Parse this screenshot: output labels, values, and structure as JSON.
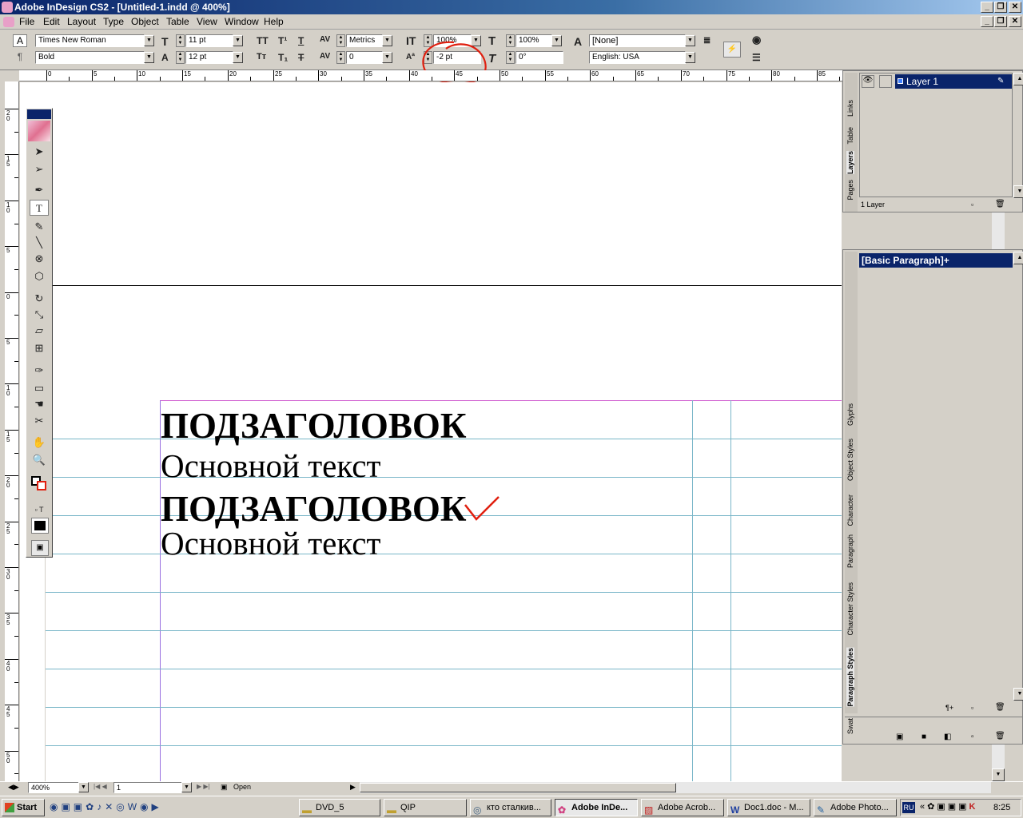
{
  "window": {
    "title": "Adobe InDesign CS2 - [Untitled-1.indd @ 400%]"
  },
  "menu": [
    "File",
    "Edit",
    "Layout",
    "Type",
    "Object",
    "Table",
    "View",
    "Window",
    "Help"
  ],
  "control_panel": {
    "font_family": "Times New Roman",
    "font_style": "Bold",
    "font_size": "11 pt",
    "leading": "12 pt",
    "kerning": "Metrics",
    "tracking": "0",
    "vertical_scale": "100%",
    "horizontal_scale": "100%",
    "baseline_shift": "-2 pt",
    "skew": "0°",
    "char_style": "[None]",
    "language": "English: USA",
    "para_mark": "¶",
    "char_mark": "A"
  },
  "ruler": {
    "h_labels": [
      "0",
      "5",
      "10",
      "15",
      "20",
      "25",
      "30",
      "35",
      "40",
      "45",
      "50",
      "55",
      "60",
      "65",
      "70",
      "75",
      "80",
      "85"
    ],
    "v_labels": [
      "20",
      "15",
      "10",
      "5",
      "0",
      "5",
      "10",
      "15",
      "20",
      "25",
      "30",
      "35",
      "40",
      "45",
      "50"
    ]
  },
  "document": {
    "lines": [
      "ПОДЗАГОЛОВОК",
      "Основной текст",
      "ПОДЗАГОЛОВОК",
      "Основной текст"
    ]
  },
  "panels": {
    "layers": {
      "tabs": [
        "Links",
        "Table",
        "Layers",
        "Pages"
      ],
      "layer_name": "Layer 1",
      "footer": "1 Layer"
    },
    "styles": {
      "current": "[Basic Paragraph]+",
      "tabs": [
        "Glyphs",
        "Object Styles",
        "Character",
        "Paragraph",
        "Character Styles",
        "Paragraph Styles"
      ],
      "swatch_tab": "Swat"
    }
  },
  "status": {
    "zoom": "400%",
    "page": "1",
    "state": "Open"
  },
  "taskbar": {
    "start": "Start",
    "items": [
      "DVD_5",
      "QIP",
      "кто сталкив...",
      "Adobe InDe...",
      "Adobe Acrob...",
      "Doc1.doc - M...",
      "Adobe Photo..."
    ],
    "lang": "RU",
    "clock": "8:25"
  },
  "colors": {
    "annotation_red": "#e02010",
    "guide_cyan": "#79b6c8",
    "margin_magenta": "#d060d0",
    "title_blue": "#0a246a"
  }
}
